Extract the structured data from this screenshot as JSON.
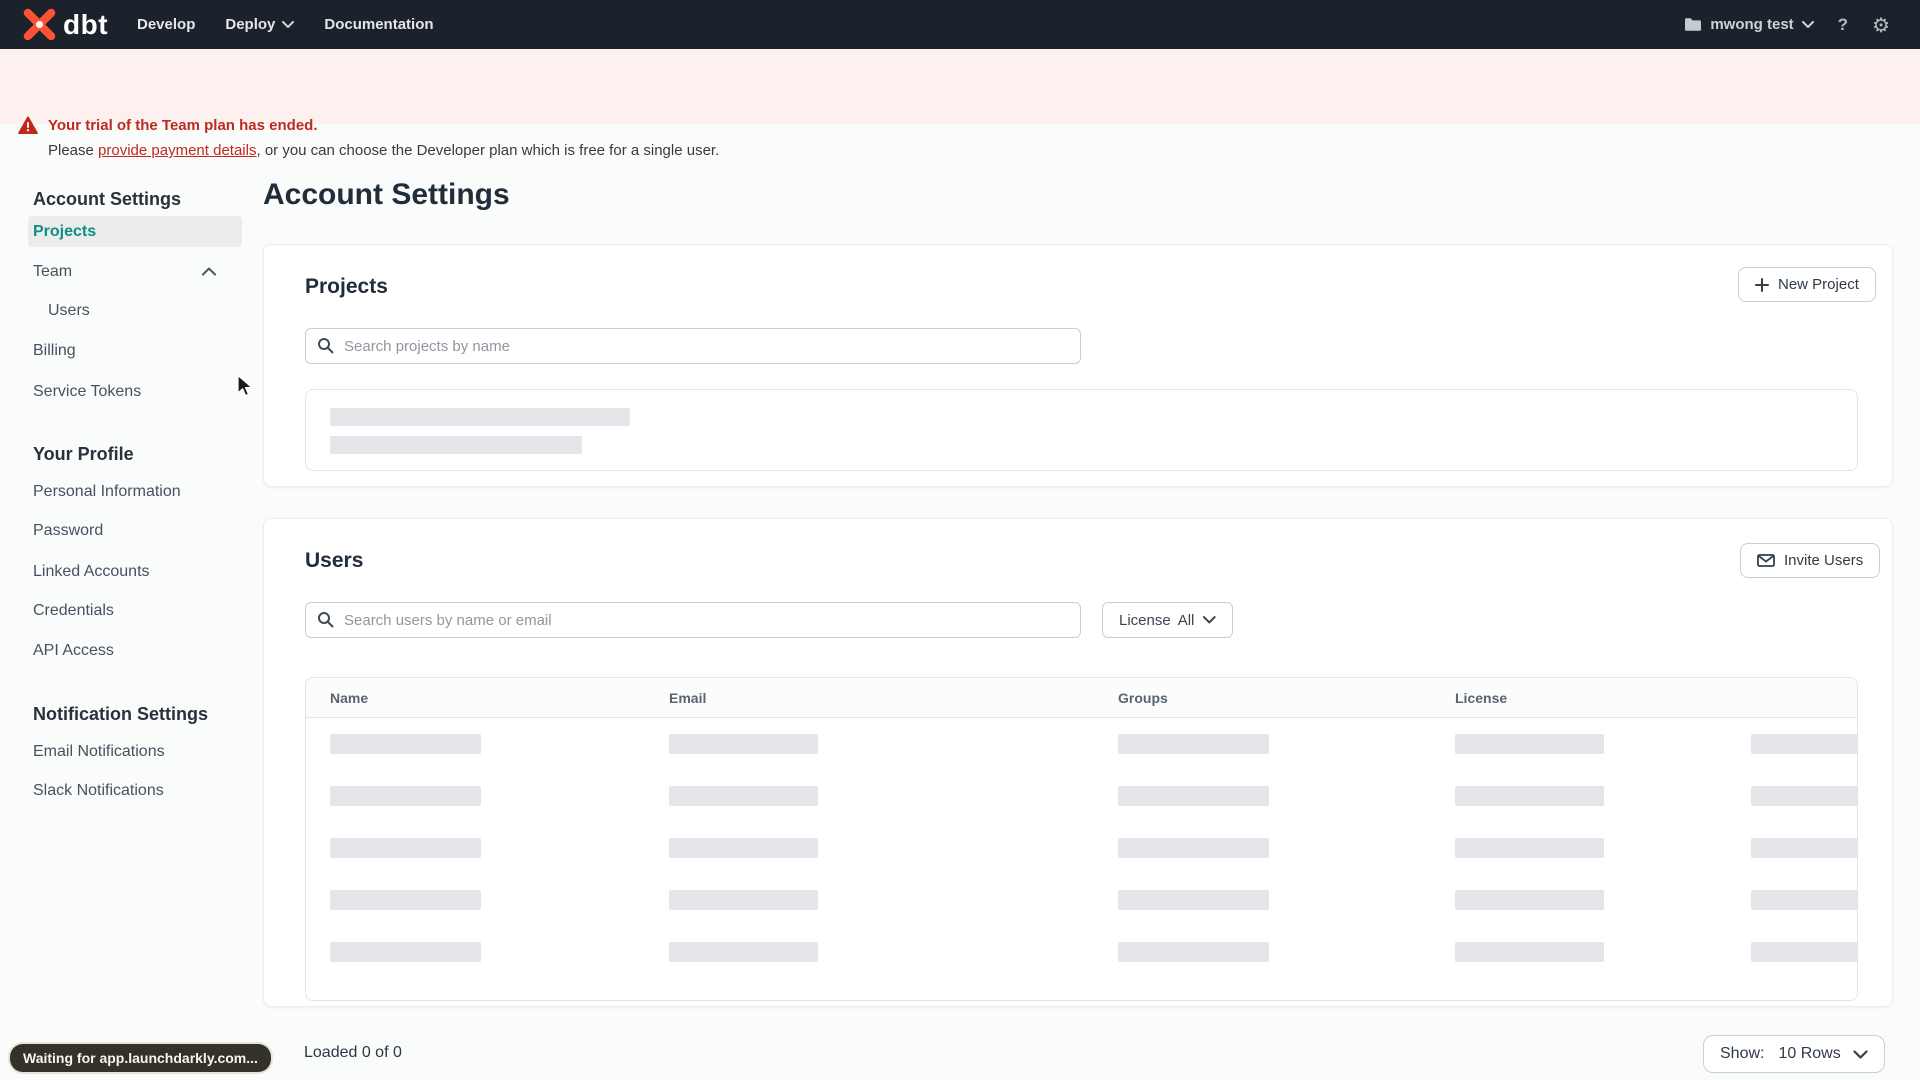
{
  "colors": {
    "nav_bg": "#1c222b",
    "brand_orange": "#ff5136",
    "active_teal": "#0f8e84",
    "banner_bg": "#fcf1ef",
    "alert_red": "#bf2a1e",
    "skeleton_gray": "#e3e5e9"
  },
  "nav": {
    "logo_text": "dbt",
    "menu": [
      {
        "label": "Develop"
      },
      {
        "label": "Deploy"
      },
      {
        "label": "Documentation"
      }
    ],
    "account_label": "mwong test",
    "help_label": "?",
    "settings_glyph": "⚙"
  },
  "banner": {
    "title": "Your trial of the Team plan has ended.",
    "body_prefix": "Please ",
    "link_text": "provide payment details",
    "body_suffix": ", or you can choose the Developer plan which is free for a single user."
  },
  "sidebar": {
    "sections": [
      {
        "heading": "Account Settings",
        "items": [
          {
            "label": "Projects"
          },
          {
            "label": "Team"
          },
          {
            "label": "Users"
          },
          {
            "label": "Billing"
          },
          {
            "label": "Service Tokens"
          }
        ]
      },
      {
        "heading": "Your Profile",
        "items": [
          {
            "label": "Personal Information"
          },
          {
            "label": "Password"
          },
          {
            "label": "Linked Accounts"
          },
          {
            "label": "Credentials"
          },
          {
            "label": "API Access"
          }
        ]
      },
      {
        "heading": "Notification Settings",
        "items": [
          {
            "label": "Email Notifications"
          },
          {
            "label": "Slack Notifications"
          }
        ]
      }
    ]
  },
  "main": {
    "page_title": "Account Settings",
    "projects": {
      "heading": "Projects",
      "new_project_button": "New Project",
      "search_placeholder": "Search projects by name"
    },
    "users": {
      "heading": "Users",
      "invite_button": "Invite Users",
      "search_placeholder": "Search users by name or email",
      "license_filter_label": "License",
      "license_filter_value": "All",
      "table_columns": [
        "Name",
        "Email",
        "Groups",
        "License"
      ],
      "loaded_status": "Loaded 0 of 0",
      "show_label": "Show:",
      "show_value": "10 Rows"
    }
  },
  "status_tooltip": "Waiting for app.launchdarkly.com..."
}
